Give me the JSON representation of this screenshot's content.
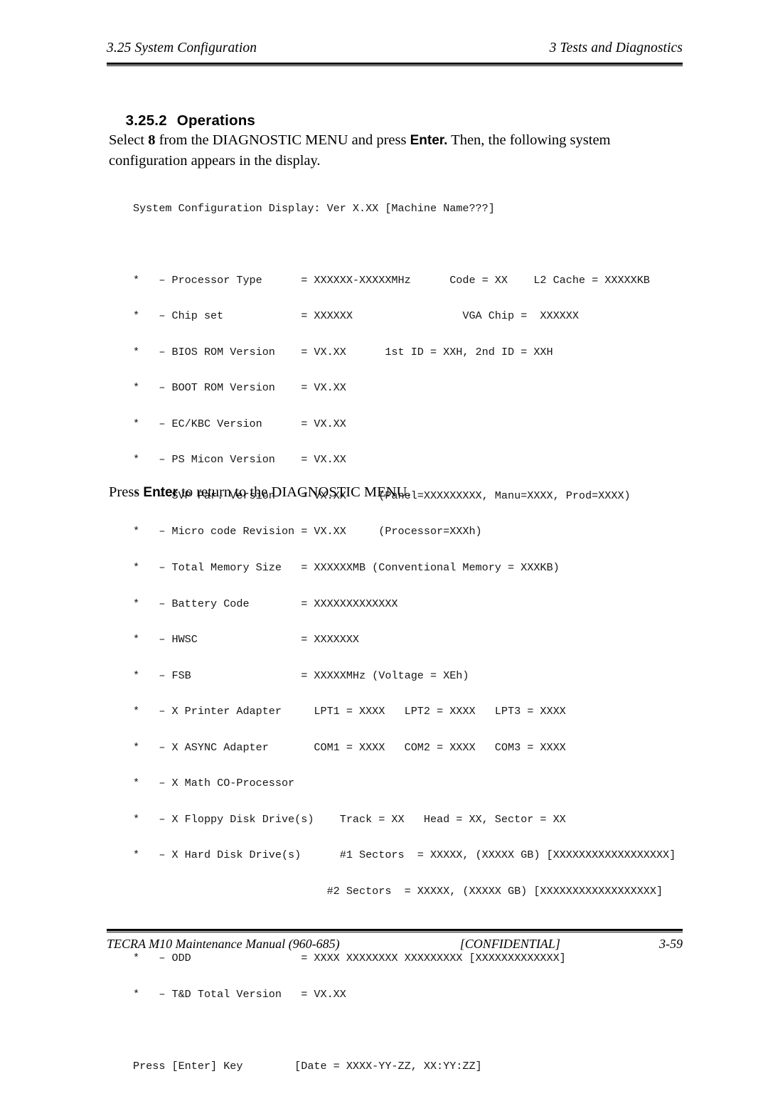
{
  "header": {
    "left": "3.25 System Configuration",
    "right": "3 Tests and Diagnostics"
  },
  "section": {
    "number": "3.25.2",
    "title": "Operations"
  },
  "intro": {
    "part1": "Select ",
    "key1": "8",
    "part2": " from the DIAGNOSTIC MENU and press ",
    "key2": "Enter.",
    "part3": " Then, the following system configuration appears in the display."
  },
  "closing": {
    "part1": "Press ",
    "key": "Enter",
    "part2": " to return to the DIAGNOSTIC MENU."
  },
  "terminal": {
    "title_line": "System Configuration Display: Ver X.XX [Machine Name???]",
    "lines": [
      "*   – Processor Type      = XXXXXX-XXXXXMHz      Code = XX    L2 Cache = XXXXXKB",
      "*   – Chip set            = XXXXXX                 VGA Chip =  XXXXXX",
      "*   – BIOS ROM Version    = VX.XX      1st ID = XXH, 2nd ID = XXH",
      "*   – BOOT ROM Version    = VX.XX",
      "*   – EC/KBC Version      = VX.XX",
      "*   – PS Micon Version    = VX.XX",
      "*   – SVP Par. Version    = VX.XX     (Panel=XXXXXXXXX, Manu=XXXX, Prod=XXXX)",
      "*   – Micro code Revision = VX.XX     (Processor=XXXh)",
      "*   – Total Memory Size   = XXXXXXMB (Conventional Memory = XXXKB)",
      "*   – Battery Code        = XXXXXXXXXXXXX",
      "*   – HWSC                = XXXXXXX",
      "*   – FSB                 = XXXXXMHz (Voltage = XEh)",
      "*   – X Printer Adapter     LPT1 = XXXX   LPT2 = XXXX   LPT3 = XXXX",
      "*   – X ASYNC Adapter       COM1 = XXXX   COM2 = XXXX   COM3 = XXXX",
      "*   – X Math CO-Processor",
      "*   – X Floppy Disk Drive(s)    Track = XX   Head = XX, Sector = XX",
      "*   – X Hard Disk Drive(s)      #1 Sectors  = XXXXX, (XXXXX GB) [XXXXXXXXXXXXXXXXXX]",
      "                              #2 Sectors  = XXXXX, (XXXXX GB) [XXXXXXXXXXXXXXXXXX]"
    ],
    "lines_tail": [
      "*   – ODD                 = XXXX XXXXXXXX XXXXXXXXX [XXXXXXXXXXXXX]",
      "*   – T&D Total Version   = VX.XX"
    ],
    "prompt_line": "Press [Enter] Key        [Date = XXXX-YY-ZZ, XX:YY:ZZ]"
  },
  "footer": {
    "left": "TECRA M10 Maintenance Manual (960-685)",
    "center": "[CONFIDENTIAL]",
    "right": "3-59"
  }
}
